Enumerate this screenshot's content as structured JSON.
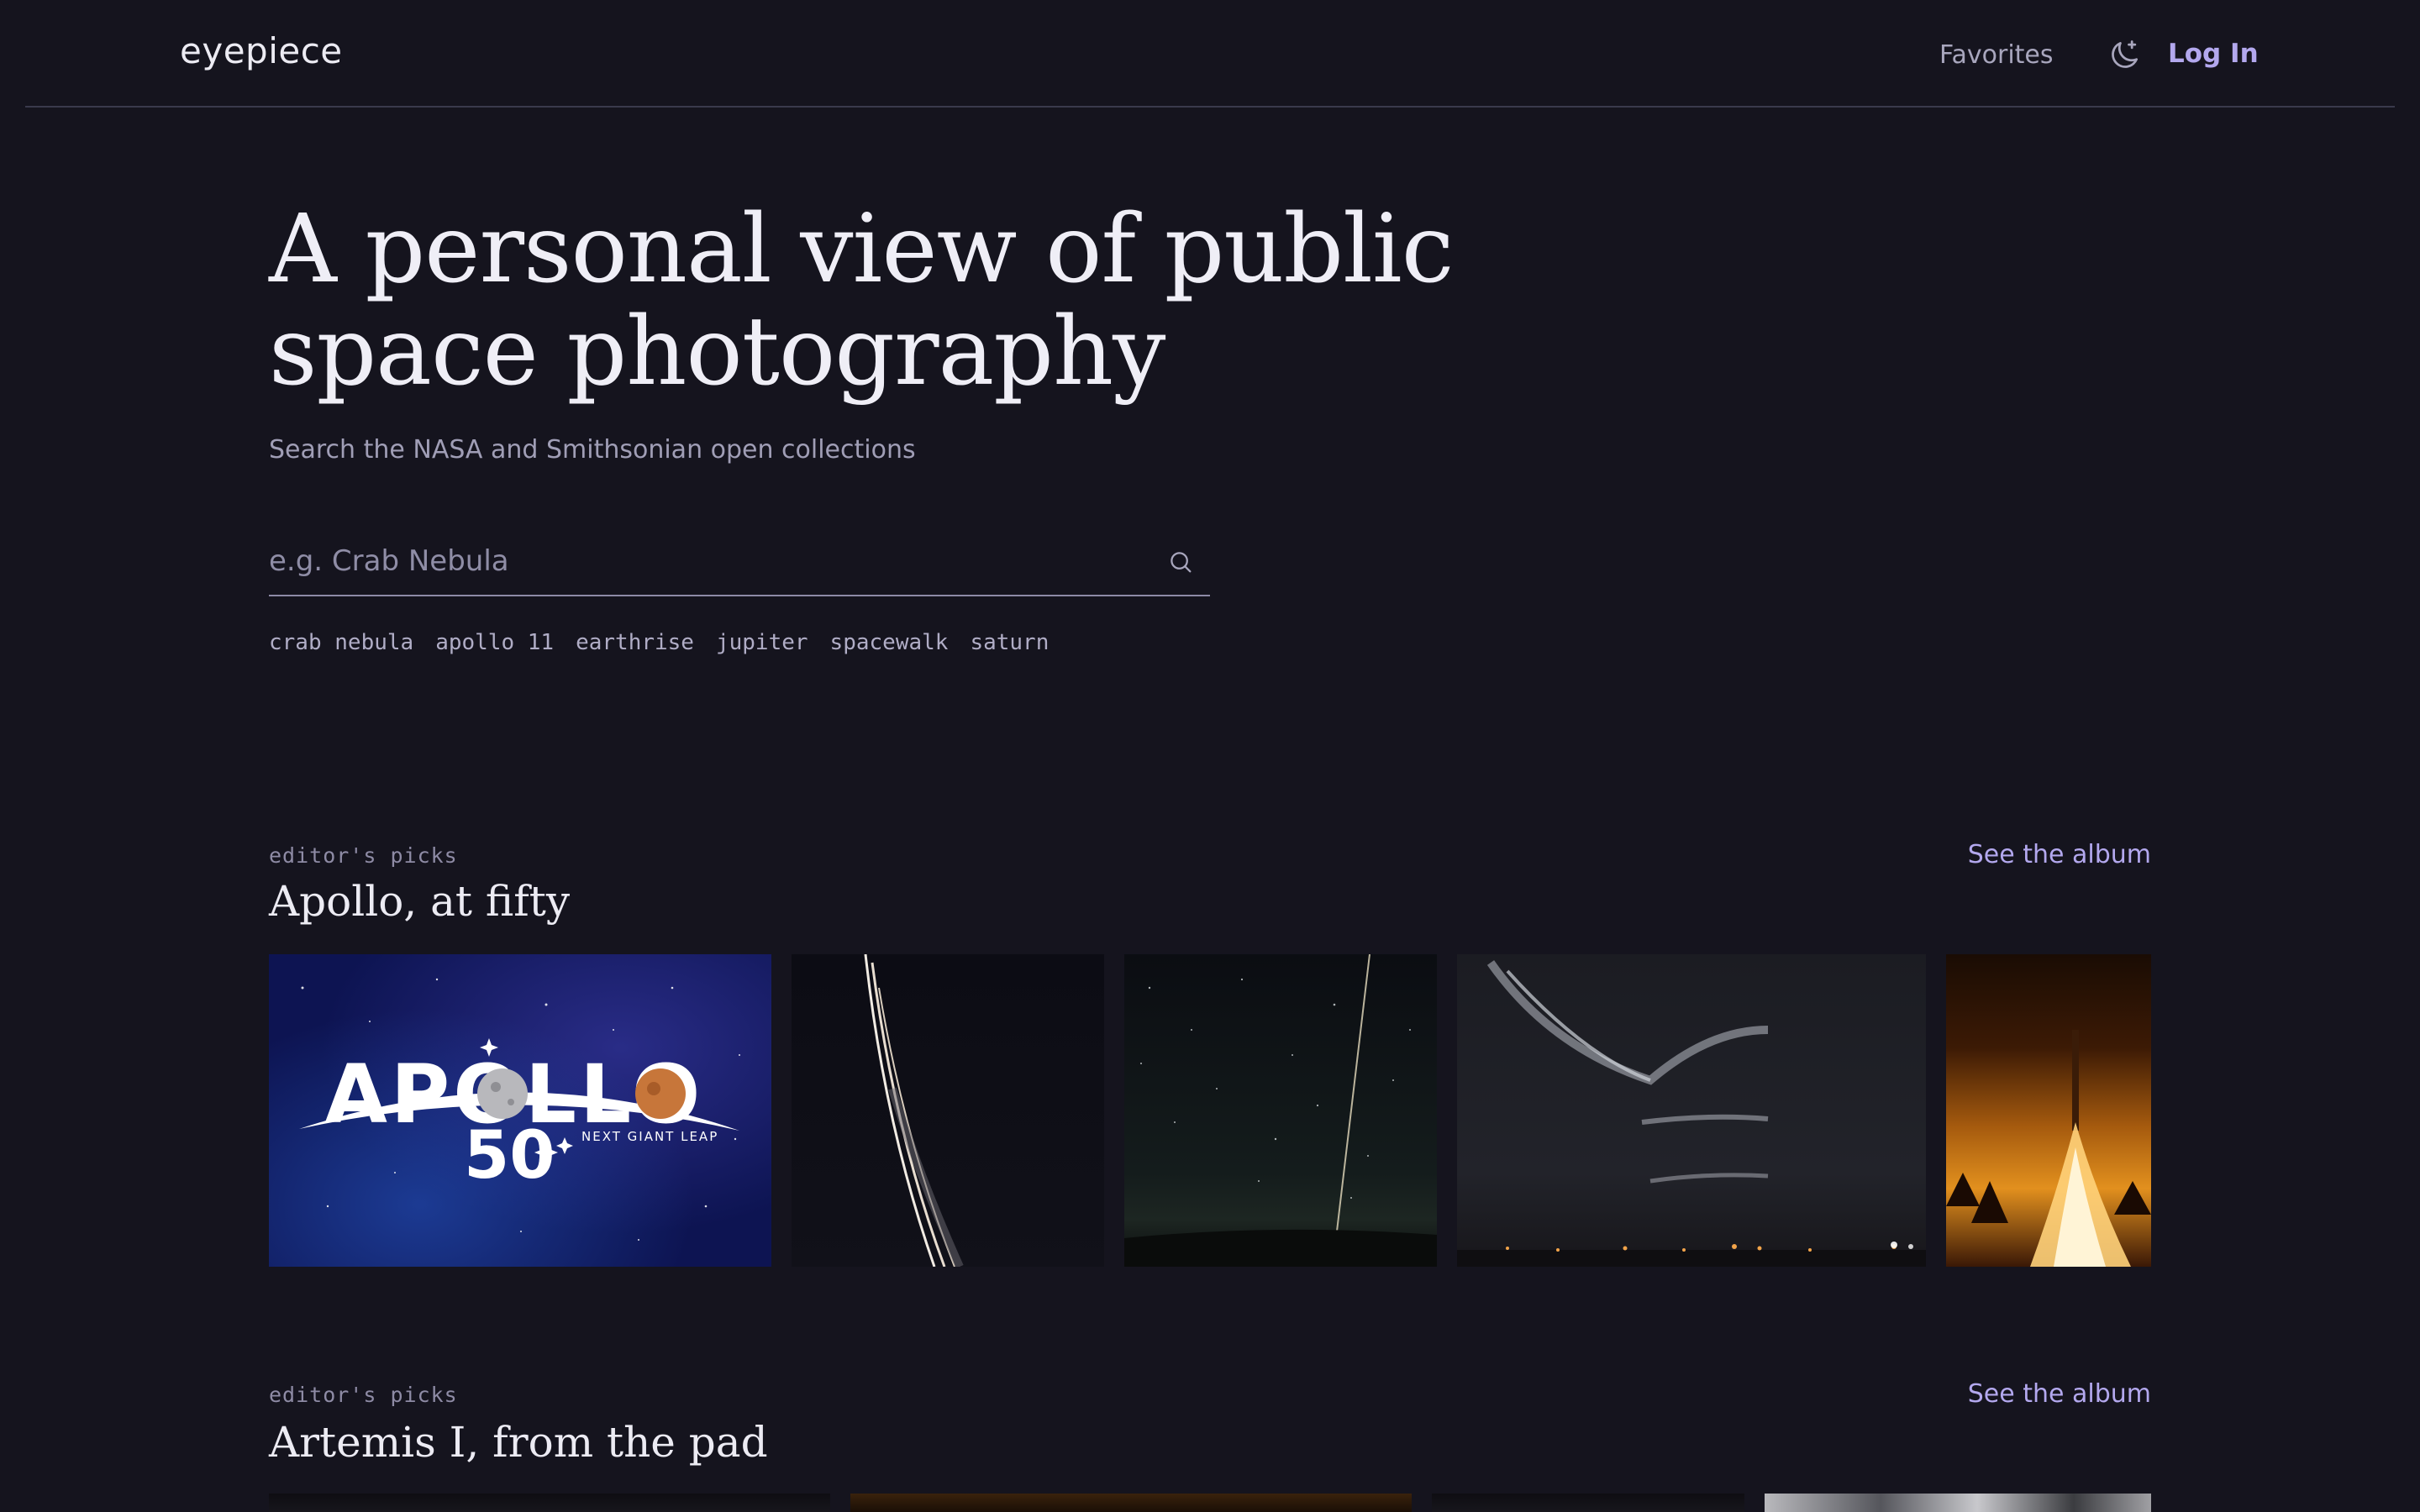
{
  "header": {
    "logo": "eyepiece",
    "nav": {
      "favorites": "Favorites",
      "login": "Log In"
    },
    "theme_icon": "moon-star-icon"
  },
  "hero": {
    "title_line1": "A personal view of public",
    "title_line2": "space photography",
    "subtitle": "Search the NASA and Smithsonian open collections",
    "search": {
      "placeholder": "e.g. Crab Nebula",
      "value": ""
    },
    "tags": [
      "crab nebula",
      "apollo 11",
      "earthrise",
      "jupiter",
      "spacewalk",
      "saturn"
    ]
  },
  "albums": [
    {
      "kicker": "editor's picks",
      "title": "Apollo, at fifty",
      "link": "See the album",
      "thumbnails": [
        {
          "name": "apollo-50-logo",
          "logo_text": "APOLLO",
          "logo_number": "50",
          "logo_tagline": "NEXT GIANT LEAP"
        },
        {
          "name": "launch-streak-night"
        },
        {
          "name": "star-trail-sky"
        },
        {
          "name": "night-clouds-launch-site"
        },
        {
          "name": "rocket-launch-fire"
        }
      ]
    },
    {
      "kicker": "editor's picks",
      "title": "Artemis I, from the pad",
      "link": "See the album",
      "thumbnails": [
        {
          "name": "artemis-thumb-1"
        },
        {
          "name": "artemis-thumb-2"
        },
        {
          "name": "artemis-thumb-3"
        },
        {
          "name": "artemis-thumb-4"
        }
      ]
    }
  ],
  "colors": {
    "background": "#15141e",
    "accent": "#b3a8ee",
    "muted_text": "#a09eb6"
  }
}
